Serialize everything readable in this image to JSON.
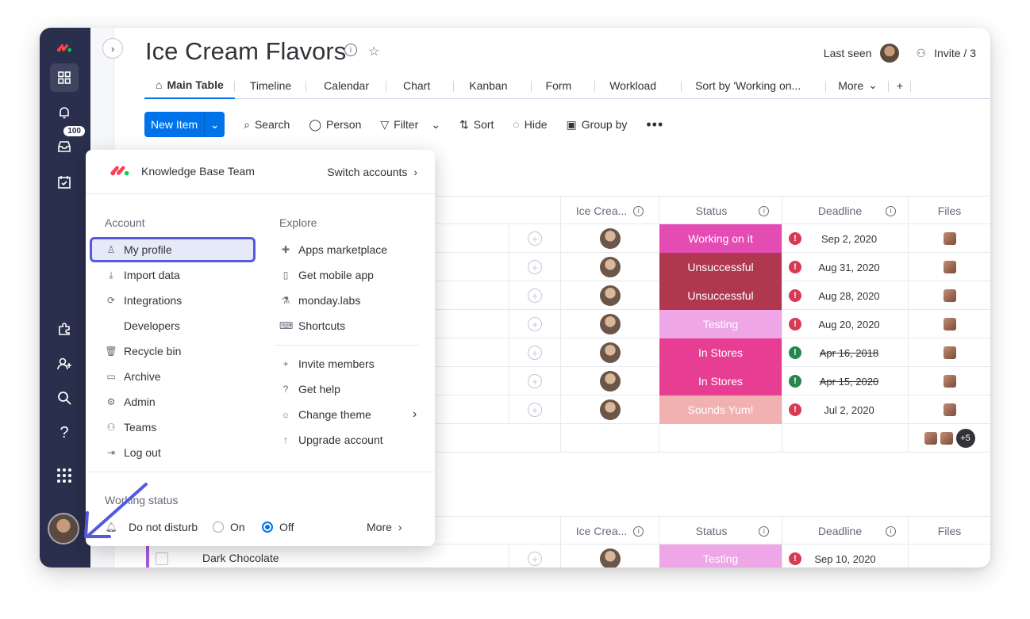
{
  "board": {
    "title": "Ice Cream Flavors",
    "last_seen": "Last seen",
    "invite": "Invite / 3"
  },
  "sidebar": {
    "inbox_badge": "100"
  },
  "tabs": [
    {
      "label": "Main Table",
      "active": true
    },
    {
      "label": "Timeline"
    },
    {
      "label": "Calendar"
    },
    {
      "label": "Chart"
    },
    {
      "label": "Kanban"
    },
    {
      "label": "Form"
    },
    {
      "label": "Workload"
    },
    {
      "label": "Sort by 'Working on..."
    },
    {
      "label": "More"
    }
  ],
  "toolbar": {
    "new_item": "New Item",
    "search": "Search",
    "person": "Person",
    "filter": "Filter",
    "sort": "Sort",
    "hide": "Hide",
    "group_by": "Group by"
  },
  "columns": {
    "ice_cream": "Ice Crea...",
    "status": "Status",
    "deadline": "Deadline",
    "files": "Files"
  },
  "rows": [
    {
      "status": "Working on it",
      "status_color": "#e44bb3",
      "deadline": "Sep 2, 2020",
      "deadline_state": "overdue",
      "struck": false
    },
    {
      "status": "Unsuccessful",
      "status_color": "#b0384e",
      "deadline": "Aug 31, 2020",
      "deadline_state": "overdue",
      "struck": false
    },
    {
      "status": "Unsuccessful",
      "status_color": "#b0384e",
      "deadline": "Aug 28, 2020",
      "deadline_state": "overdue",
      "struck": false
    },
    {
      "status": "Testing",
      "status_color": "#efa6e6",
      "deadline": "Aug 20, 2020",
      "deadline_state": "overdue",
      "struck": false
    },
    {
      "status": "In Stores",
      "status_color": "#e73e93",
      "deadline": "Apr 16, 2018",
      "deadline_state": "done",
      "struck": true
    },
    {
      "status": "In Stores",
      "status_color": "#e73e93",
      "deadline": "Apr 15, 2020",
      "deadline_state": "done",
      "struck": true
    },
    {
      "status": "Sounds Yum!",
      "status_color": "#f0b1b0",
      "deadline": "Jul 2, 2020",
      "deadline_state": "overdue",
      "struck": false
    }
  ],
  "files_summary": "+5",
  "group2": {
    "first_item": "Dark Chocolate",
    "status": "Testing",
    "status_color": "#efa6e6",
    "deadline": "Sep 10, 2020"
  },
  "popup": {
    "team": "Knowledge Base Team",
    "switch_accounts": "Switch accounts",
    "account_title": "Account",
    "account_items": [
      {
        "label": "My profile",
        "icon": "user-icon"
      },
      {
        "label": "Import data",
        "icon": "download-icon"
      },
      {
        "label": "Integrations",
        "icon": "integrations-icon"
      },
      {
        "label": "Developers",
        "icon": "code-icon"
      },
      {
        "label": "Recycle bin",
        "icon": "trash-icon"
      },
      {
        "label": "Archive",
        "icon": "archive-icon"
      },
      {
        "label": "Admin",
        "icon": "gear-icon"
      },
      {
        "label": "Teams",
        "icon": "team-icon"
      },
      {
        "label": "Log out",
        "icon": "logout-icon"
      }
    ],
    "explore_title": "Explore",
    "explore_items": [
      {
        "label": "Apps marketplace",
        "icon": "puzzle-icon"
      },
      {
        "label": "Get mobile app",
        "icon": "mobile-icon"
      },
      {
        "label": "monday.labs",
        "icon": "flask-icon"
      },
      {
        "label": "Shortcuts",
        "icon": "keyboard-icon"
      }
    ],
    "more_items": [
      {
        "label": "Invite members",
        "icon": "plus-icon"
      },
      {
        "label": "Get help",
        "icon": "help-icon"
      },
      {
        "label": "Change theme",
        "icon": "sun-icon"
      },
      {
        "label": "Upgrade account",
        "icon": "arrow-up-icon"
      }
    ],
    "working_status": "Working status",
    "dnd": "Do not disturb",
    "on": "On",
    "off": "Off",
    "more": "More"
  },
  "colors": {
    "sidebar": "#292f4c",
    "accent": "#0073ea",
    "highlight": "#5559df",
    "overdue": "#d83a52",
    "done": "#258750"
  }
}
